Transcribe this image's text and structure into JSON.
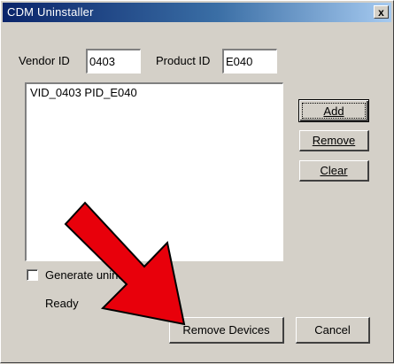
{
  "window": {
    "title": "CDM Uninstaller",
    "close_label": "x"
  },
  "form": {
    "vendor_id_label": "Vendor ID",
    "vendor_id_value": "0403",
    "product_id_label": "Product ID",
    "product_id_value": "E040"
  },
  "device_list": {
    "items": [
      "VID_0403 PID_E040"
    ]
  },
  "side_buttons": {
    "add_label": "Add",
    "remove_label": "Remove",
    "clear_label": "Clear"
  },
  "options": {
    "generate_log_label": "Generate uninstall log file",
    "generate_log_checked": false
  },
  "status": {
    "text": "Ready"
  },
  "footer": {
    "remove_devices_label": "Remove Devices",
    "cancel_label": "Cancel"
  },
  "annotation": {
    "arrow_color": "#e8000b",
    "arrow_outline": "#000000"
  }
}
